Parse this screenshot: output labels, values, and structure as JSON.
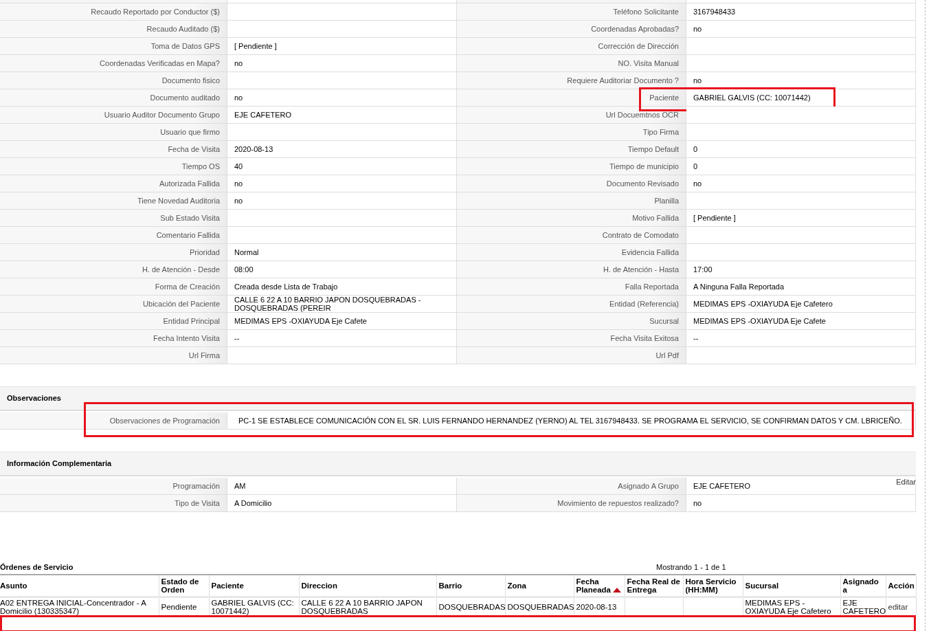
{
  "detail_rows": [
    {
      "left": {
        "label": "Recaudo Reportado por Conductor ($)",
        "highlighted": false
      },
      "right": {
        "label": "Teléfono Solicitante",
        "value": "3167948433",
        "highlighted": false
      }
    },
    {
      "left": {
        "label": "Recaudo Auditado ($)",
        "highlighted": false
      },
      "right": {
        "label": "Coordenadas Aprobadas?",
        "value": "no",
        "highlighted": false
      }
    },
    {
      "left": {
        "label": "Toma de Datos GPS",
        "value": "[ Pendiente ]",
        "highlighted": false
      },
      "right": {
        "label": "Corrección de Dirección",
        "highlighted": false
      }
    },
    {
      "left": {
        "label": "Coordenadas Verificadas en Mapa?",
        "value": "no",
        "highlighted": false
      },
      "right": {
        "label": "NO. Visita Manual",
        "highlighted": false
      }
    },
    {
      "left": {
        "label": "Documento fisico",
        "highlighted": false
      },
      "right": {
        "label": "Requiere Auditoriar Documento ?",
        "value": "no",
        "highlighted": false
      }
    },
    {
      "left": {
        "label": "Documento auditado",
        "value": "no",
        "highlighted": false
      },
      "right": {
        "label": "Paciente",
        "value": "GABRIEL GALVIS (CC: 10071442)",
        "highlighted": true
      }
    },
    {
      "left": {
        "label": "Usuario Auditor Documento Grupo",
        "value": "EJE CAFETERO",
        "highlighted": false
      },
      "right": {
        "label": "Url Docuemtnos OCR",
        "highlighted": false
      }
    },
    {
      "left": {
        "label": "Usuario que firmo",
        "highlighted": false
      },
      "right": {
        "label": "Tipo Firma",
        "highlighted": false
      }
    },
    {
      "left": {
        "label": "Fecha de Visita",
        "value": "2020-08-13",
        "highlighted": false
      },
      "right": {
        "label": "Tiempo Default",
        "value": "0",
        "highlighted": false
      }
    },
    {
      "left": {
        "label": "Tiempo OS",
        "value": "40",
        "highlighted": false
      },
      "right": {
        "label": "Tiempo de municipio",
        "value": "0",
        "highlighted": false
      }
    },
    {
      "left": {
        "label": "Autorizada Fallida",
        "value": "no",
        "highlighted": false
      },
      "right": {
        "label": "Documento Revisado",
        "value": "no",
        "highlighted": false
      }
    },
    {
      "left": {
        "label": "Tiene Novedad Auditoria",
        "value": "no",
        "highlighted": false
      },
      "right": {
        "label": "Planilla",
        "highlighted": false
      }
    },
    {
      "left": {
        "label": "Sub Estado Visita",
        "highlighted": false
      },
      "right": {
        "label": "Motivo Fallida",
        "value": "[ Pendiente ]",
        "highlighted": false
      }
    },
    {
      "left": {
        "label": "Comentario Fallida",
        "highlighted": false
      },
      "right": {
        "label": "Contrato de Comodato",
        "highlighted": false
      }
    },
    {
      "left": {
        "label": "Prioridad",
        "value": "Normal",
        "highlighted": false
      },
      "right": {
        "label": "Evidencia Fallida",
        "highlighted": false
      }
    },
    {
      "left": {
        "label": "H. de Atención - Desde",
        "value": "08:00",
        "highlighted": false
      },
      "right": {
        "label": "H. de Atención - Hasta",
        "value": "17:00",
        "highlighted": false
      }
    },
    {
      "left": {
        "label": "Forma de Creación",
        "value": "Creada desde Lista de Trabajo",
        "highlighted": false
      },
      "right": {
        "label": "Falla Reportada",
        "value": "A Ninguna Falla Reportada",
        "highlighted": false
      }
    },
    {
      "left": {
        "label": "Ubicación del Paciente",
        "value": "CALLE 6 22 A 10 BARRIO JAPON DOSQUEBRADAS - DOSQUEBRADAS (PEREIR",
        "highlighted": false
      },
      "right": {
        "label": "Entidad (Referencia)",
        "value": "MEDIMAS EPS -OXIAYUDA Eje Cafetero",
        "highlighted": false
      }
    },
    {
      "left": {
        "label": "Entidad Principal",
        "value": "MEDIMAS EPS -OXIAYUDA Eje Cafete",
        "highlighted": false
      },
      "right": {
        "label": "Sucursal",
        "value": "MEDIMAS EPS -OXIAYUDA Eje Cafete",
        "highlighted": false
      }
    },
    {
      "left": {
        "label": "Fecha Intento Visita",
        "value": "--",
        "highlighted": false
      },
      "right": {
        "label": "Fecha Visita Exitosa",
        "value": "--",
        "highlighted": false
      }
    },
    {
      "left": {
        "label": "Url Firma",
        "highlighted": false
      },
      "right": {
        "label": "Url Pdf",
        "highlighted": false
      }
    }
  ],
  "observaciones": {
    "title": "Observaciones",
    "rows": [
      {
        "label": "Observaciones de Programación",
        "value": "PC-1 SE ESTABLECE COMUNICACIÓN CON EL SR. LUIS FERNANDO HERNANDEZ (YERNO) AL TEL 3167948433. SE PROGRAMA EL SERVICIO, SE CONFIRMAN DATOS Y CM. LBRICEÑO.",
        "highlighted": true
      }
    ]
  },
  "complementaria": {
    "title": "Información Complementaria",
    "edit_link": "Editar",
    "rows": [
      {
        "left": {
          "label": "Programación",
          "value": "AM",
          "highlighted": false
        },
        "right": {
          "label": "Asignado A Grupo",
          "value": "EJE CAFETERO",
          "highlighted": false
        }
      },
      {
        "left": {
          "label": "Tipo de Visita",
          "value": "A Domicilio",
          "highlighted": false
        },
        "right": {
          "label": "Movimiento de repuestos realizado?",
          "value": "no",
          "highlighted": false
        }
      }
    ]
  },
  "orders": {
    "title": "Órdenes de Servicio",
    "count": "Mostrando 1 - 1 de 1",
    "highlight_band": true,
    "columns": [
      {
        "label": "Asunto",
        "sorted": false
      },
      {
        "label": "Estado de Orden",
        "sorted": false
      },
      {
        "label": "Paciente",
        "sorted": false
      },
      {
        "label": "Direccion",
        "sorted": false
      },
      {
        "label": "Barrio",
        "sorted": false
      },
      {
        "label": "Zona",
        "sorted": false
      },
      {
        "label": "Fecha Planeada",
        "sorted": true
      },
      {
        "label": "Fecha Real de Entrega",
        "sorted": false
      },
      {
        "label": "Hora Servicio (HH:MM)",
        "sorted": false
      },
      {
        "label": "Sucursal",
        "sorted": false
      },
      {
        "label": "Asignado a",
        "sorted": false
      },
      {
        "label": "Acción",
        "sorted": false
      }
    ],
    "rows": [
      {
        "cells": [
          "A02 ENTREGA INICIAL-Concentrador - A Domicilio (130335347)",
          "Pendiente",
          "GABRIEL GALVIS (CC: 10071442)",
          "CALLE 6 22 A 10 BARRIO JAPON DOSQUEBRADAS",
          "DOSQUEBRADAS",
          "DOSQUEBRADAS",
          "2020-08-13",
          null,
          null,
          "MEDIMAS EPS - OXIAYUDA Eje Cafetero",
          "EJE CAFETERO",
          "editar"
        ]
      }
    ]
  }
}
